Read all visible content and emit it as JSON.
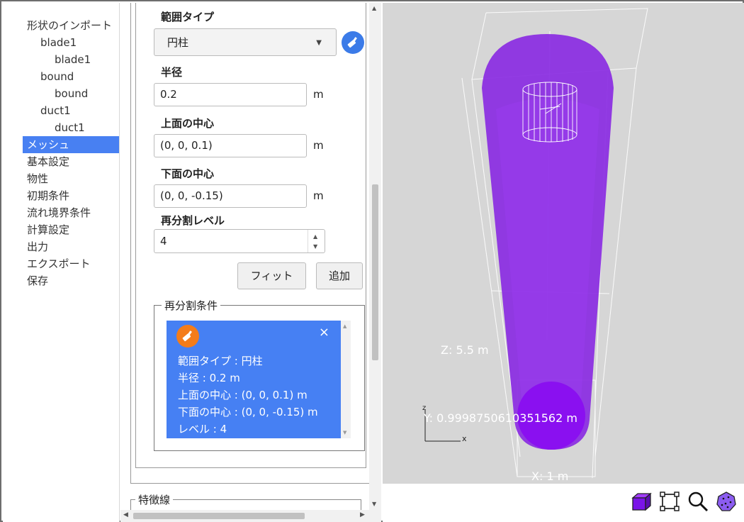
{
  "nav": {
    "items": [
      {
        "label": "形状のインポート",
        "level": 0
      },
      {
        "label": "blade1",
        "level": 1
      },
      {
        "label": "blade1",
        "level": 2
      },
      {
        "label": "bound",
        "level": 1
      },
      {
        "label": "bound",
        "level": 2
      },
      {
        "label": "duct1",
        "level": 1
      },
      {
        "label": "duct1",
        "level": 2
      },
      {
        "label": "メッシュ",
        "level": 0,
        "active": true
      },
      {
        "label": "基本設定",
        "level": 0
      },
      {
        "label": "物性",
        "level": 0
      },
      {
        "label": "初期条件",
        "level": 0
      },
      {
        "label": "流れ境界条件",
        "level": 0
      },
      {
        "label": "計算設定",
        "level": 0
      },
      {
        "label": "出力",
        "level": 0
      },
      {
        "label": "エクスポート",
        "level": 0
      },
      {
        "label": "保存",
        "level": 0
      }
    ]
  },
  "form": {
    "range_type_label": "範囲タイプ",
    "range_type_value": "円柱",
    "radius_label": "半径",
    "radius_value": "0.2",
    "radius_unit": "m",
    "top_center_label": "上面の中心",
    "top_center_value": "(0, 0, 0.1)",
    "top_center_unit": "m",
    "bottom_center_label": "下面の中心",
    "bottom_center_value": "(0, 0, -0.15)",
    "bottom_center_unit": "m",
    "level_label": "再分割レベル",
    "level_value": "4",
    "fit_button": "フィット",
    "add_button": "追加"
  },
  "conditions": {
    "legend": "再分割条件",
    "card": {
      "line1": "範囲タイプ : 円柱",
      "line2": "半径 : 0.2 m",
      "line3": "上面の中心 : (0, 0, 0.1) m",
      "line4": "下面の中心 : (0, 0, -0.15) m",
      "line5": "レベル : 4",
      "close": "×"
    }
  },
  "features": {
    "legend": "特徴線"
  },
  "viewport": {
    "z_label": "Z: 5.5 m",
    "y_label": "Y: 0.999875061035156 2 m",
    "y_label_text": "Y: 0.9998750610351562 m",
    "x_label": "X: 1 m",
    "axis_y": "y",
    "axis_z": "z",
    "axis_x": "x",
    "mesh_color": "#8a2be2"
  },
  "toolbar": {
    "icons": [
      "cube-view-icon",
      "fit-bounds-icon",
      "zoom-icon",
      "point-cloud-icon"
    ]
  }
}
